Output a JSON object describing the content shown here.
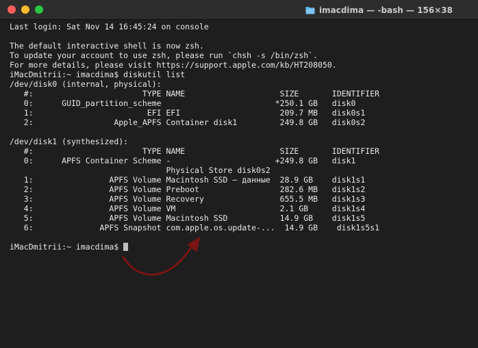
{
  "window": {
    "title": "imacdima — -bash — 156×38"
  },
  "terminal": {
    "lines": [
      "Last login: Sat Nov 14 16:45:24 on console",
      "",
      "The default interactive shell is now zsh.",
      "To update your account to use zsh, please run `chsh -s /bin/zsh`.",
      "For more details, please visit https://support.apple.com/kb/HT208050.",
      "iMacDmitrii:~ imacdima$ diskutil list",
      "/dev/disk0 (internal, physical):",
      "   #:                       TYPE NAME                    SIZE       IDENTIFIER",
      "   0:      GUID_partition_scheme                        *250.1 GB   disk0",
      "   1:                        EFI EFI                     209.7 MB   disk0s1",
      "   2:                 Apple_APFS Container disk1         249.8 GB   disk0s2",
      "",
      "/dev/disk1 (synthesized):",
      "   #:                       TYPE NAME                    SIZE       IDENTIFIER",
      "   0:      APFS Container Scheme -                      +249.8 GB   disk1",
      "                                 Physical Store disk0s2",
      "   1:                APFS Volume Macintosh SSD — данные  28.9 GB    disk1s1",
      "   2:                APFS Volume Preboot                 282.6 MB   disk1s2",
      "   3:                APFS Volume Recovery                655.5 MB   disk1s3",
      "   4:                APFS Volume VM                      2.1 GB     disk1s4",
      "   5:                APFS Volume Macintosh SSD           14.9 GB    disk1s5",
      "   6:              APFS Snapshot com.apple.os.update-...  14.9 GB    disk1s5s1",
      "",
      "iMacDmitrii:~ imacdima$ "
    ]
  },
  "colors": {
    "background": "#1e1e1e",
    "titlebar": "#2d2d2d",
    "text": "#e8e8e8",
    "arrow": "#8b1a1a",
    "close": "#ff5f57",
    "minimize": "#febc2e",
    "maximize": "#28c840"
  },
  "icons": {
    "title_icon": "folder-icon",
    "annotation": "curved-arrow-icon"
  }
}
